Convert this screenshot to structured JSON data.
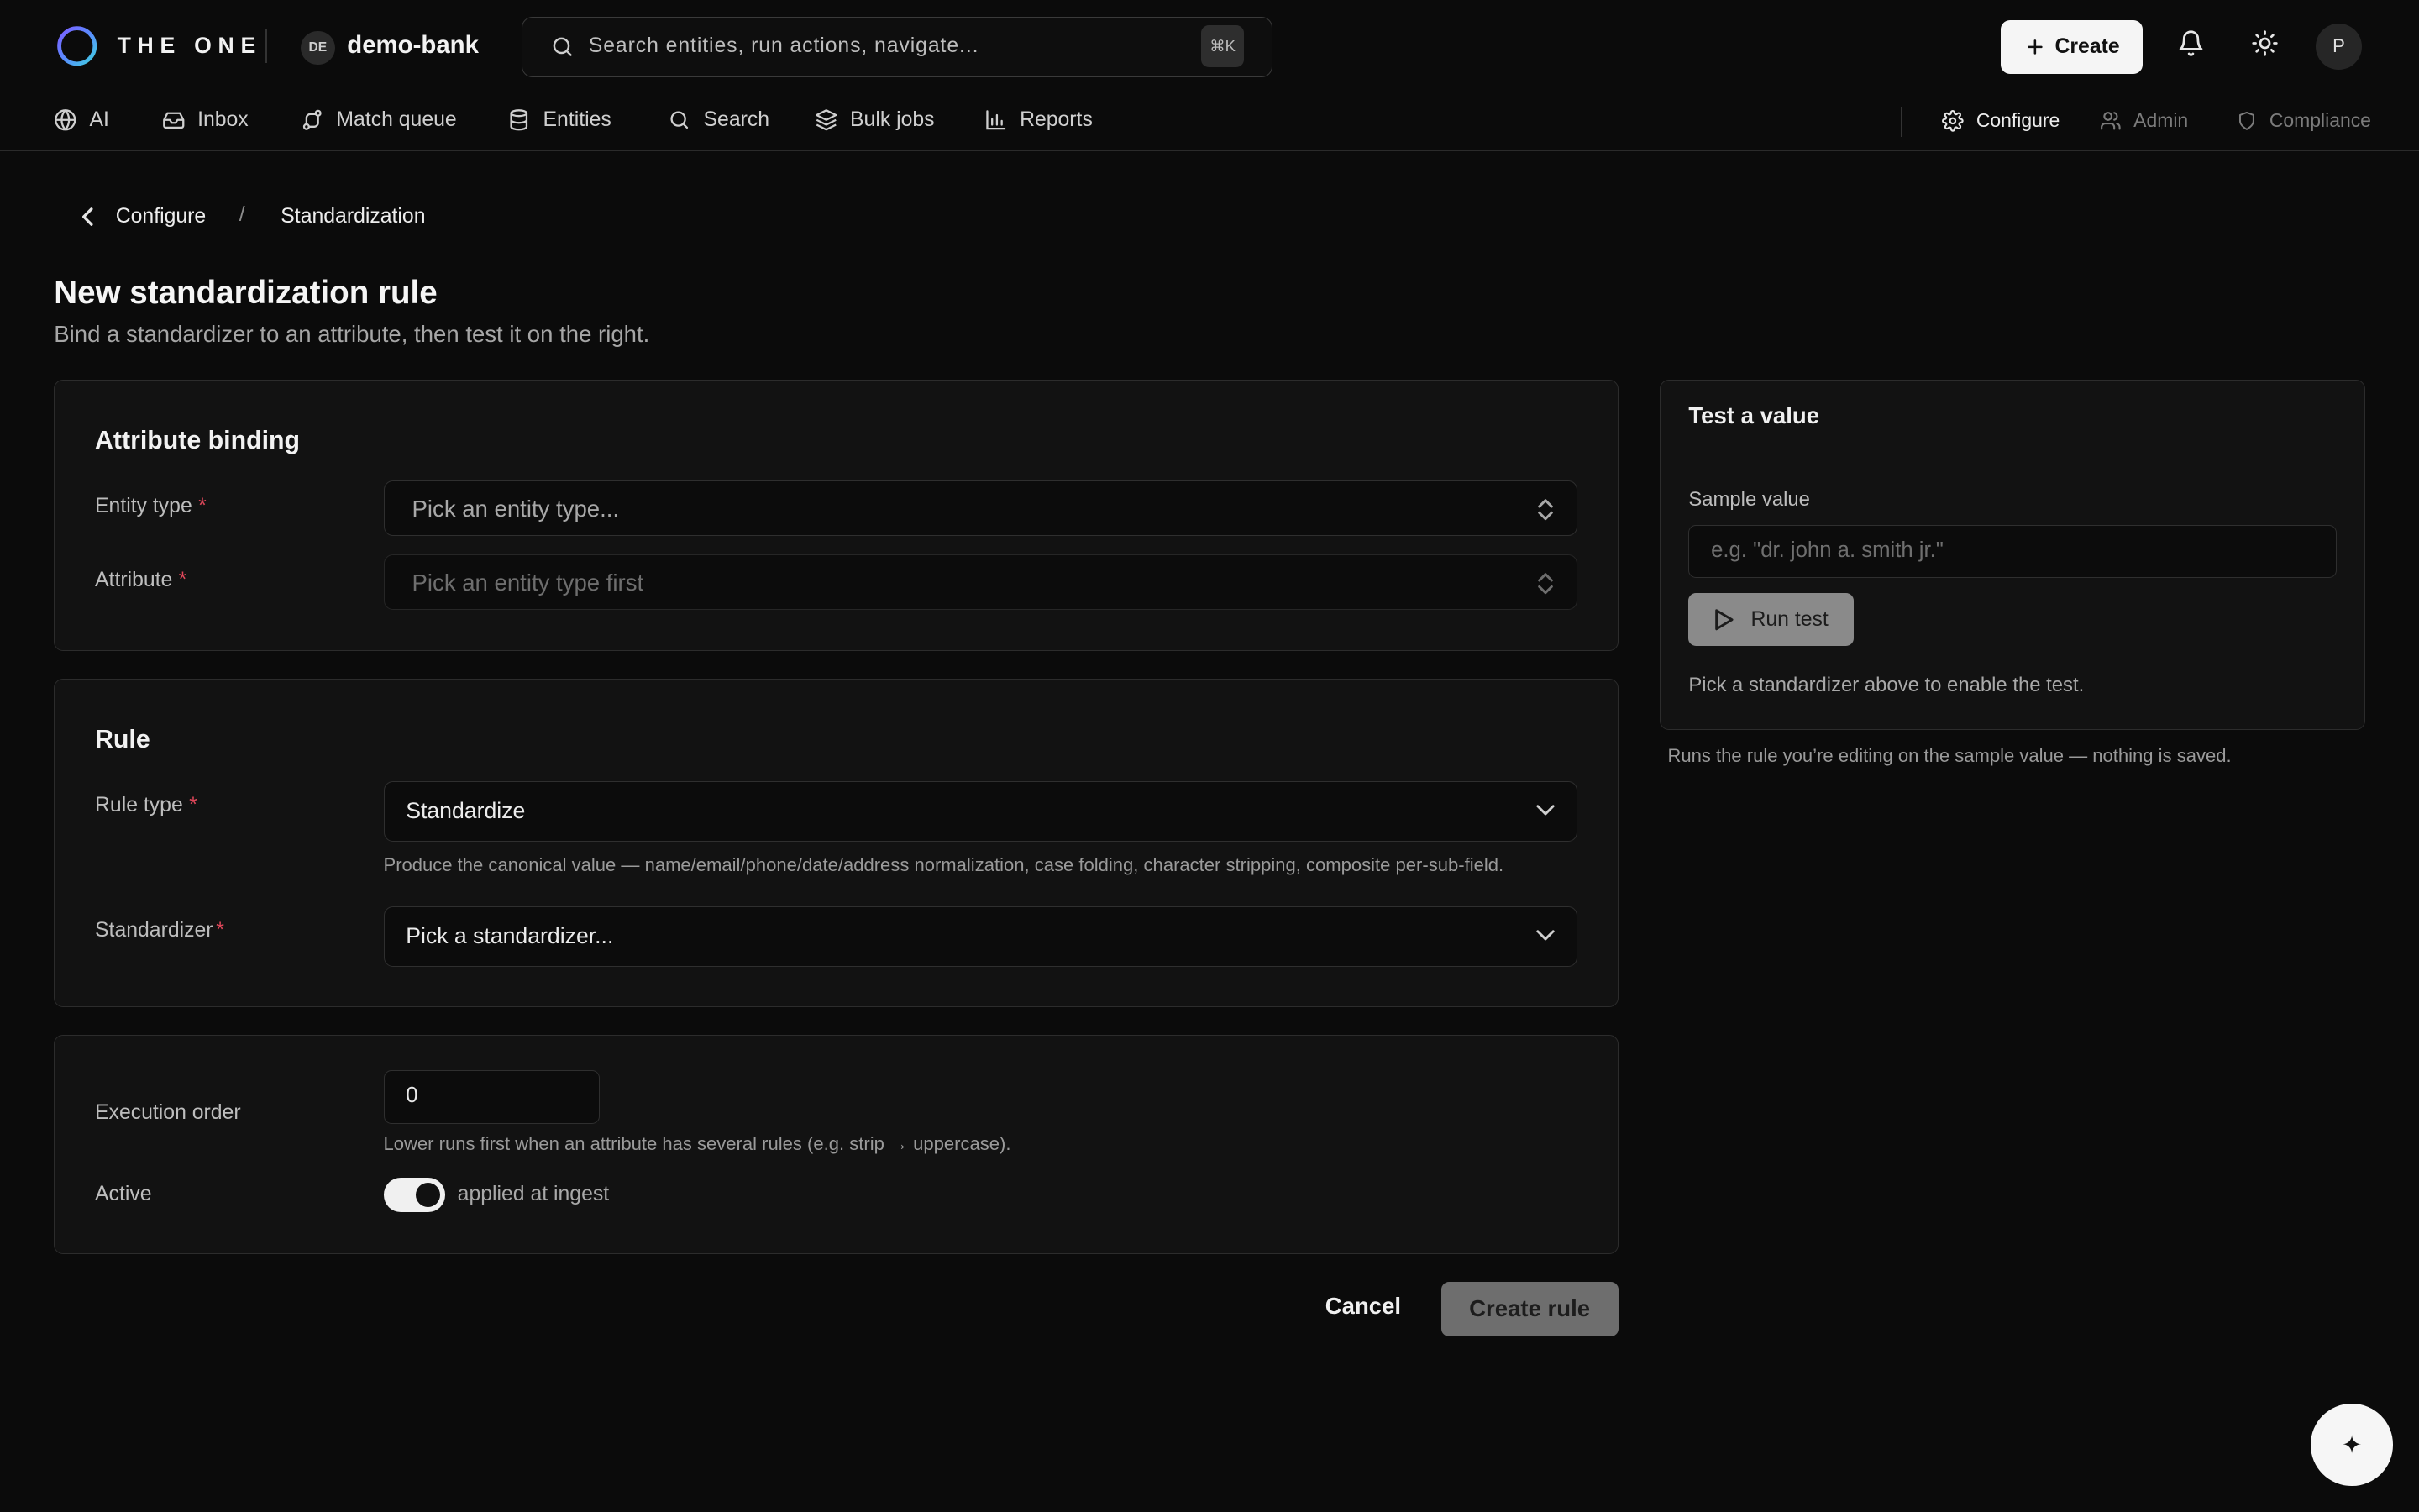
{
  "header": {
    "brand": "THE ONE",
    "workspace_badge": "DE",
    "workspace_name": "demo-bank",
    "search_placeholder": "Search entities, run actions, navigate...",
    "search_shortcut": "⌘K",
    "create_label": "Create",
    "avatar_initial": "P"
  },
  "nav": {
    "items": [
      {
        "label": "AI",
        "icon": "globe-icon"
      },
      {
        "label": "Inbox",
        "icon": "inbox-icon"
      },
      {
        "label": "Match queue",
        "icon": "route-icon"
      },
      {
        "label": "Entities",
        "icon": "database-icon"
      },
      {
        "label": "Search",
        "icon": "search-icon"
      },
      {
        "label": "Bulk jobs",
        "icon": "layers-icon"
      },
      {
        "label": "Reports",
        "icon": "bar-chart-icon"
      }
    ],
    "right_items": [
      {
        "label": "Configure",
        "icon": "gear-icon",
        "state": "active"
      },
      {
        "label": "Admin",
        "icon": "users-icon",
        "state": "dim"
      },
      {
        "label": "Compliance",
        "icon": "shield-icon",
        "state": "dim"
      }
    ]
  },
  "breadcrumb": {
    "back_label": "Configure",
    "separator": "/",
    "current": "Standardization"
  },
  "page": {
    "title": "New standardization rule",
    "subtitle": "Bind a standardizer to an attribute, then test it on the right."
  },
  "binding": {
    "title": "Attribute binding",
    "entity_type_label": "Entity type",
    "entity_type_placeholder": "Pick an entity type...",
    "attribute_label": "Attribute",
    "attribute_placeholder": "Pick an entity type first",
    "required_mark": "*"
  },
  "rule": {
    "title": "Rule",
    "rule_type_label": "Rule type",
    "rule_type_value": "Standardize",
    "rule_type_hint": "Produce the canonical value — name/email/phone/date/address normalization, case folding, character stripping, composite per-sub-field.",
    "standardizer_label": "Standardizer",
    "standardizer_placeholder": "Pick a standardizer..."
  },
  "execution": {
    "order_label": "Execution order",
    "order_value": "0",
    "order_hint": "Lower runs first when an attribute has several rules (e.g. strip → uppercase).",
    "active_label": "Active",
    "active_on": true,
    "active_hint": "applied at ingest"
  },
  "actions": {
    "cancel_label": "Cancel",
    "create_label": "Create rule"
  },
  "test_panel": {
    "title": "Test a value",
    "sample_label": "Sample value",
    "sample_placeholder": "e.g. \"dr. john a. smith jr.\"",
    "run_label": "Run test",
    "note": "Pick a standardizer above to enable the test.",
    "footer": "Runs the rule you’re editing on the sample value — nothing is saved."
  },
  "fab": {
    "icon": "sparkle-icon",
    "glyph": "✦"
  },
  "colors": {
    "background": "#0b0b0b",
    "card": "#121212",
    "required": "#e0475a",
    "primary_button": "#f5f5f5"
  }
}
